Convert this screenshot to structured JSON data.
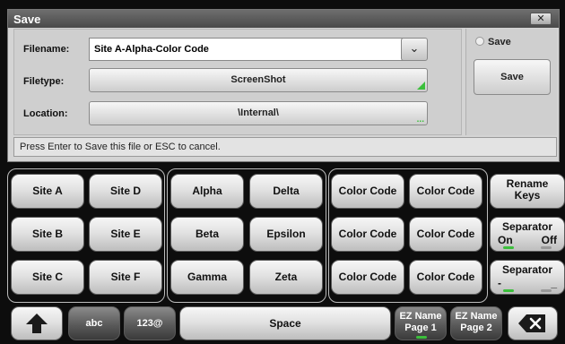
{
  "dialog": {
    "title": "Save",
    "close_glyph": "✕",
    "filename_label": "Filename:",
    "filename_value": "Site A-Alpha-Color Code",
    "dropdown_glyph": "⌄",
    "filetype_label": "Filetype:",
    "filetype_value": "ScreenShot",
    "location_label": "Location:",
    "location_value": "\\Internal\\",
    "location_dots": "...",
    "save_checkbox_label": "Save",
    "save_button": "Save",
    "status": "Press Enter to Save this file or ESC to cancel."
  },
  "keys": {
    "site": [
      "Site A",
      "Site D",
      "Site B",
      "Site E",
      "Site C",
      "Site F"
    ],
    "greek": [
      "Alpha",
      "Delta",
      "Beta",
      "Epsilon",
      "Gamma",
      "Zeta"
    ],
    "color": [
      "Color Code",
      "Color Code",
      "Color Code",
      "Color Code",
      "Color Code",
      "Color Code"
    ],
    "rename": [
      "Rename",
      "Keys"
    ],
    "separator1": {
      "title": "Separator",
      "on": "On",
      "off": "Off"
    },
    "separator2": {
      "title": "Separator",
      "left": "-",
      "right": "_"
    }
  },
  "bottom": {
    "shift_icon": "shift-arrow-icon",
    "abc": "abc",
    "num": "123@",
    "space": "Space",
    "ez1": [
      "EZ Name",
      "Page 1"
    ],
    "ez2": [
      "EZ Name",
      "Page 2"
    ],
    "backspace_glyph": "✕",
    "backspace_icon": "backspace-icon"
  },
  "colors": {
    "accent_green": "#3bbf3b",
    "background": "#0d0d0d",
    "dialog": "#d4d4d4"
  }
}
